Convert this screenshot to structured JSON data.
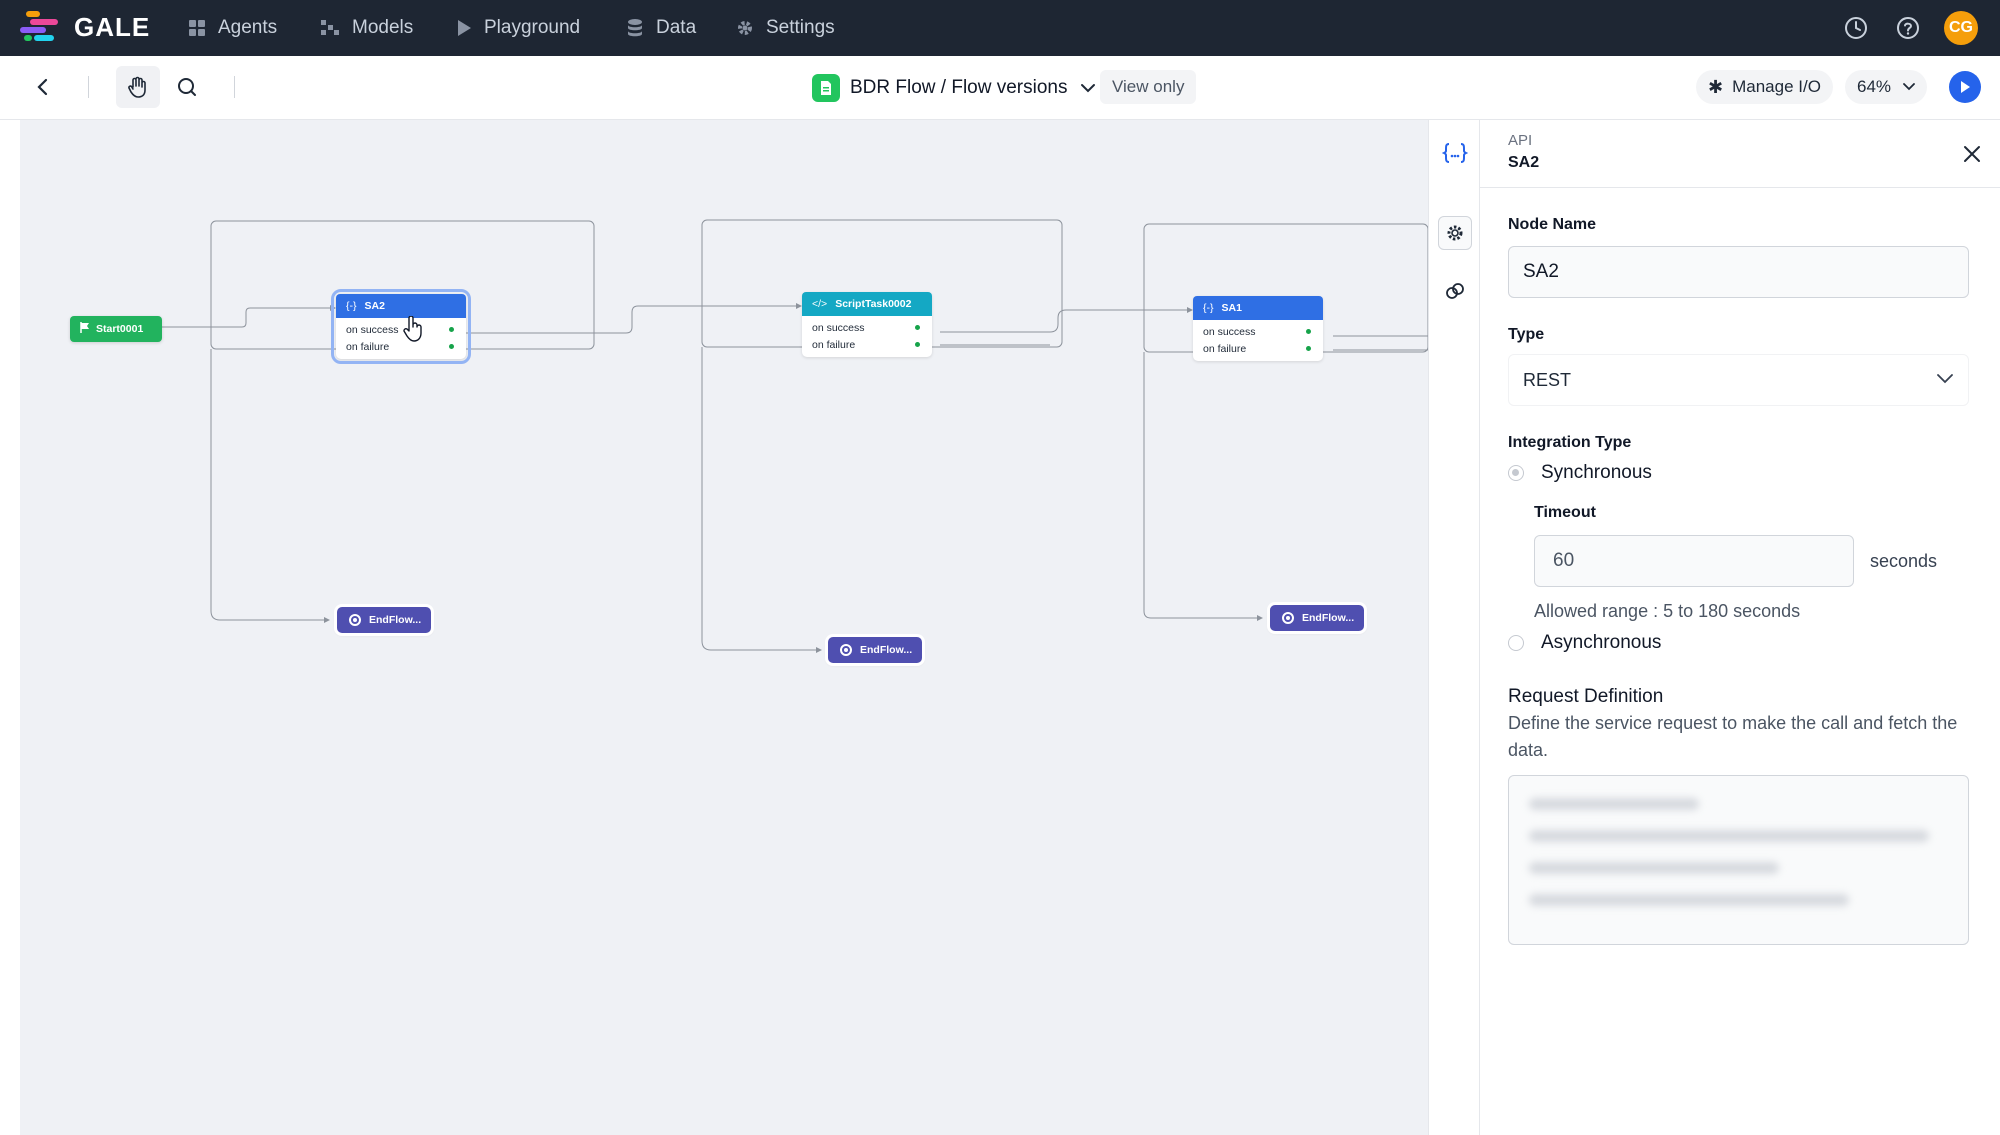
{
  "app": {
    "name": "GALE"
  },
  "nav": {
    "items": [
      {
        "label": "Agents",
        "icon": "grid-icon"
      },
      {
        "label": "Models",
        "icon": "models-icon"
      },
      {
        "label": "Playground",
        "icon": "play-icon"
      },
      {
        "label": "Data",
        "icon": "database-icon"
      },
      {
        "label": "Settings",
        "icon": "gear-icon"
      }
    ],
    "avatar_initials": "CG"
  },
  "toolbar": {
    "flow_title": "BDR Flow / Flow versions",
    "view_mode": "View only",
    "manage_io": "Manage I/O",
    "zoom": "64%"
  },
  "canvas": {
    "start_node": "Start0001",
    "nodes": [
      {
        "title": "SA2",
        "type": "api",
        "outputs": [
          "on success",
          "on failure"
        ],
        "selected": true
      },
      {
        "title": "ScriptTask0002",
        "type": "script",
        "outputs": [
          "on success",
          "on failure"
        ],
        "selected": false
      },
      {
        "title": "SA1",
        "type": "api",
        "outputs": [
          "on success",
          "on failure"
        ],
        "selected": false
      }
    ],
    "end_nodes": [
      "EndFlow...",
      "EndFlow...",
      "EndFlow..."
    ]
  },
  "panel": {
    "kind": "API",
    "name": "SA2",
    "node_name_label": "Node Name",
    "node_name_value": "SA2",
    "type_label": "Type",
    "type_value": "REST",
    "integration_type_label": "Integration Type",
    "sync_label": "Synchronous",
    "timeout_label": "Timeout",
    "timeout_value": "60",
    "timeout_unit": "seconds",
    "timeout_hint": "Allowed range : 5 to 180 seconds",
    "async_label": "Asynchronous",
    "request_def_title": "Request Definition",
    "request_def_desc": "Define the service request to make the call and fetch the data."
  },
  "colors": {
    "nav_bg": "#1e2633",
    "api_node_header": "#2f6fe4",
    "script_node_header": "#14a8c4",
    "start_node": "#22b35e",
    "end_node": "#4f4fb0",
    "accent": "#2563eb"
  }
}
